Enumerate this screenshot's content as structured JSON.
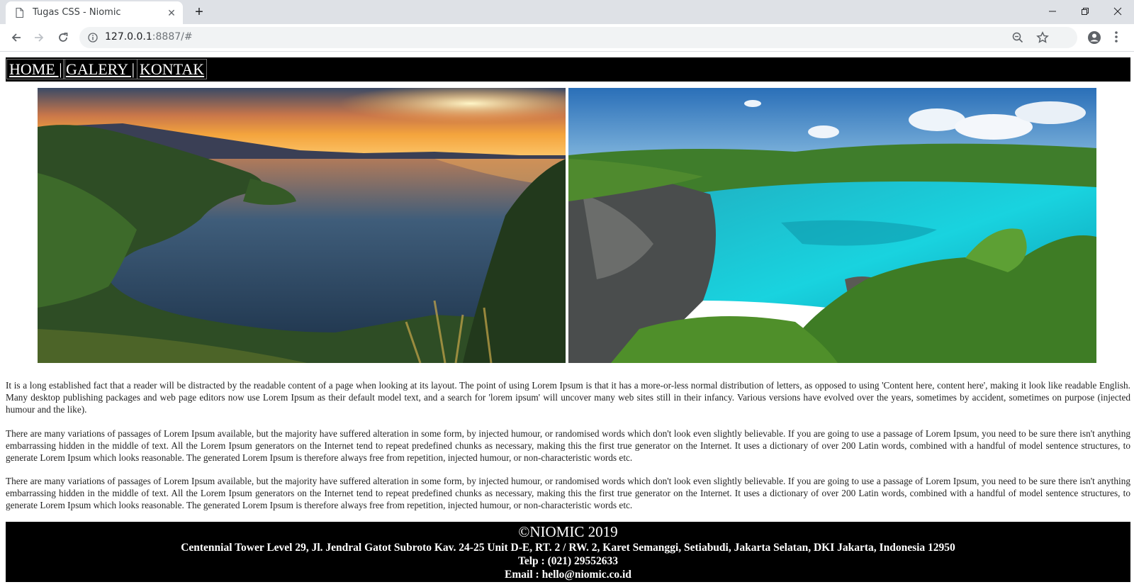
{
  "browser": {
    "tab_title": "Tugas CSS - Niomic",
    "url_host": "127.0.0.1",
    "url_rest": ":8887/#"
  },
  "nav": {
    "items": [
      {
        "label": "HOME |"
      },
      {
        "label": "GALERY |"
      },
      {
        "label": "KONTAK"
      }
    ]
  },
  "gallery": {
    "images": [
      {
        "name": "sunset lake with mountains"
      },
      {
        "name": "turquoise lagoon with rocks"
      }
    ]
  },
  "content": {
    "paragraphs": [
      "It is a long established fact that a reader will be distracted by the readable content of a page when looking at its layout. The point of using Lorem Ipsum is that it has a more-or-less normal distribution of letters, as opposed to using 'Content here, content here', making it look like readable English. Many desktop publishing packages and web page editors now use Lorem Ipsum as their default model text, and a search for 'lorem ipsum' will uncover many web sites still in their infancy. Various versions have evolved over the years, sometimes by accident, sometimes on purpose (injected humour and the like).",
      "There are many variations of passages of Lorem Ipsum available, but the majority have suffered alteration in some form, by injected humour, or randomised words which don't look even slightly believable. If you are going to use a passage of Lorem Ipsum, you need to be sure there isn't anything embarrassing hidden in the middle of text. All the Lorem Ipsum generators on the Internet tend to repeat predefined chunks as necessary, making this the first true generator on the Internet. It uses a dictionary of over 200 Latin words, combined with a handful of model sentence structures, to generate Lorem Ipsum which looks reasonable. The generated Lorem Ipsum is therefore always free from repetition, injected humour, or non-characteristic words etc.",
      "There are many variations of passages of Lorem Ipsum available, but the majority have suffered alteration in some form, by injected humour, or randomised words which don't look even slightly believable. If you are going to use a passage of Lorem Ipsum, you need to be sure there isn't anything embarrassing hidden in the middle of text. All the Lorem Ipsum generators on the Internet tend to repeat predefined chunks as necessary, making this the first true generator on the Internet. It uses a dictionary of over 200 Latin words, combined with a handful of model sentence structures, to generate Lorem Ipsum which looks reasonable. The generated Lorem Ipsum is therefore always free from repetition, injected humour, or non-characteristic words etc."
    ]
  },
  "footer": {
    "copyright": "©NIOMIC 2019",
    "address": "Centennial Tower Level 29, Jl. Jendral Gatot Subroto Kav. 24-25 Unit D-E, RT. 2 / RW. 2, Karet Semanggi, Setiabudi, Jakarta Selatan, DKI Jakarta, Indonesia 12950",
    "phone": "Telp : (021) 29552633",
    "email": "Email : hello@niomic.co.id"
  },
  "colors": {
    "nav_bg": "#000000",
    "footer_bg": "#000000",
    "chrome_bg": "#dee1e6"
  }
}
